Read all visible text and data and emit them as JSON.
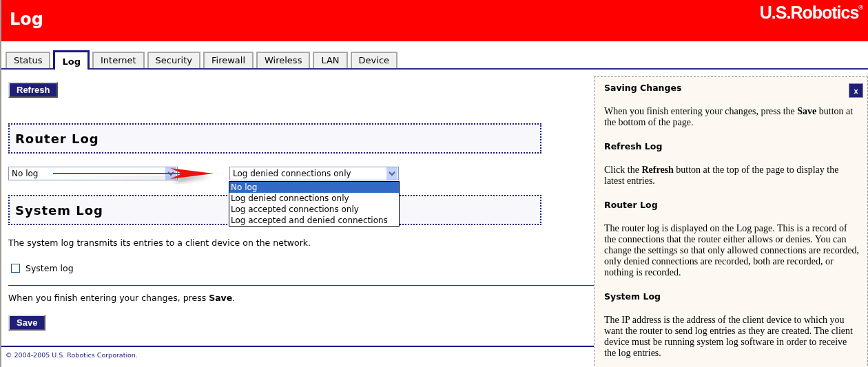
{
  "header": {
    "title": "Log",
    "logo": "U.S.Robotics$^{®}$"
  },
  "tabs": [
    {
      "label": "Status",
      "selected": false
    },
    {
      "label": "Log",
      "selected": true
    },
    {
      "label": "Internet",
      "selected": false
    },
    {
      "label": "Security",
      "selected": false
    },
    {
      "label": "Firewall",
      "selected": false
    },
    {
      "label": "Wireless",
      "selected": false
    },
    {
      "label": "LAN",
      "selected": false
    },
    {
      "label": "Device",
      "selected": false
    }
  ],
  "refresh_button": "Refresh",
  "router_log": {
    "heading": "Router Log",
    "before_select": {
      "value": "No log"
    },
    "after_select": {
      "value": "Log denied connections only",
      "expanded": true,
      "options": [
        {
          "label": "No log",
          "highlighted": true
        },
        {
          "label": "Log denied connections only",
          "highlighted": false
        },
        {
          "label": "Log accepted connections only",
          "highlighted": false
        },
        {
          "label": "Log accepted and denied connections",
          "highlighted": false
        }
      ]
    }
  },
  "system_log": {
    "heading": "System Log",
    "description": "The system log transmits its entries to a client device on the network.",
    "checkbox": {
      "label": "System log",
      "checked": false
    }
  },
  "save_note": "When you finish entering your changes, press **Save**.",
  "save_button": "Save",
  "footer": "© 2004-2005 U.S. Robotics Corporation.",
  "help": {
    "close": "x",
    "sections": [
      {
        "heading": "Saving Changes",
        "text": "When you finish entering your changes, press the **Save** button at the bottom of the page."
      },
      {
        "heading": "Refresh Log",
        "text": "Click the **Refresh** button at the top of the page to display the latest entries."
      },
      {
        "heading": "Router Log",
        "text": "The router log is displayed on the Log page. This is a record of the connections that the router either allows or denies. You can change the settings so that only allowed connections are recorded, only denied connections are recorded, both are recorded, or nothing is recorded."
      },
      {
        "heading": "System Log",
        "text": "The IP address is the address of the client device to which you want the router to send log entries as they are created. The client device must be running system log software in order to receive the log entries."
      }
    ]
  }
}
